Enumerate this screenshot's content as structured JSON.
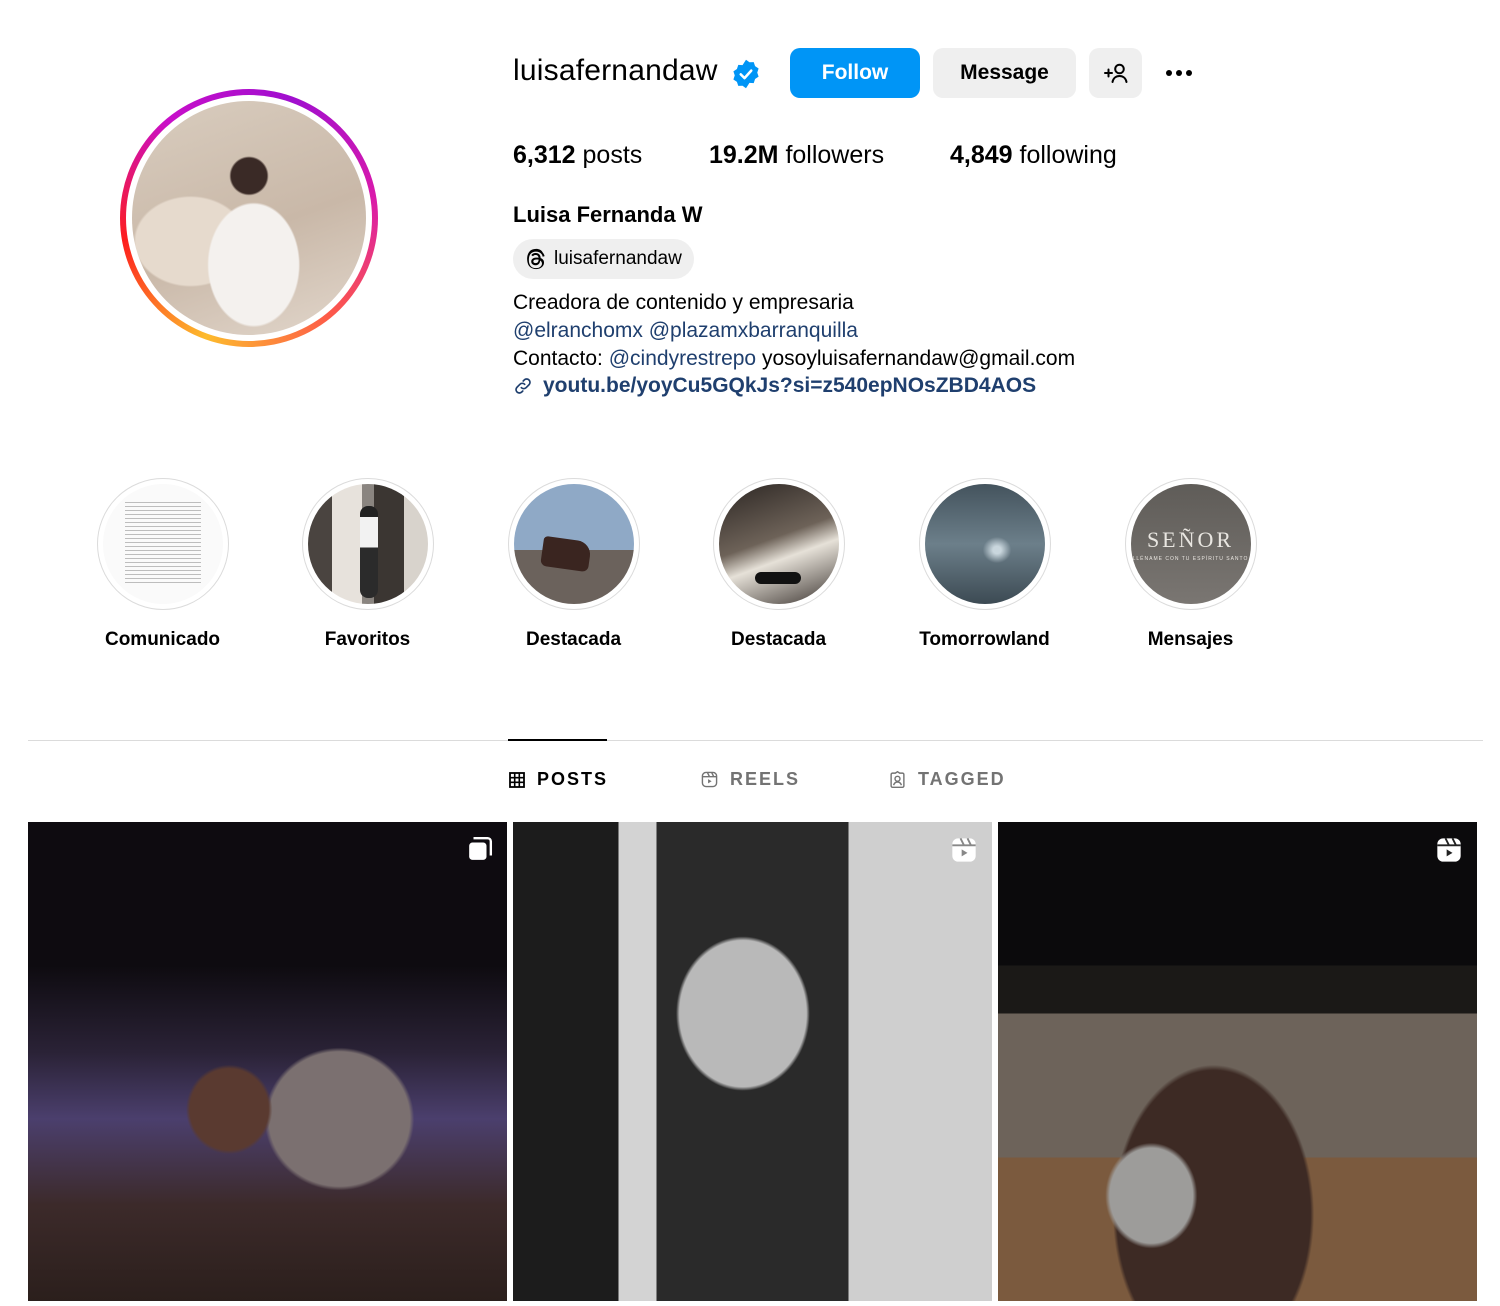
{
  "profile": {
    "username": "luisafernandaw",
    "verified": true,
    "full_name": "Luisa Fernanda W",
    "threads_handle": "luisafernandaw",
    "accent_color": "#0095f6",
    "avatar_alt": "Profile photo"
  },
  "actions": {
    "follow_label": "Follow",
    "message_label": "Message"
  },
  "stats": {
    "posts_count": "6,312",
    "posts_label": "posts",
    "followers_count": "19.2M",
    "followers_label": "followers",
    "following_count": "4,849",
    "following_label": "following"
  },
  "bio": {
    "line1": "Creadora de contenido y empresaria",
    "mention1": "@elranchomx",
    "mention2": "@plazamxbarranquilla",
    "contact_prefix": "Contacto:",
    "contact_mention": "@cindyrestrepo",
    "contact_email": "yosoyluisafernandaw@gmail.com",
    "link": "youtu.be/yoyCu5GQkJs?si=z540epNOsZBD4AOS"
  },
  "highlights": [
    {
      "label": "Comunicado"
    },
    {
      "label": "Favoritos"
    },
    {
      "label": "Destacada"
    },
    {
      "label": "Destacada"
    },
    {
      "label": "Tomorrowland"
    },
    {
      "label": "Mensajes"
    }
  ],
  "highlight_text": {
    "mensajes_title": "SEÑOR",
    "mensajes_sub": "LLÉNAME CON TU ESPÍRITU SANTO"
  },
  "tabs": [
    {
      "label": "POSTS",
      "active": true,
      "icon": "grid-icon"
    },
    {
      "label": "REELS",
      "active": false,
      "icon": "reels-icon"
    },
    {
      "label": "TAGGED",
      "active": false,
      "icon": "tagged-icon"
    }
  ],
  "posts": [
    {
      "type": "carousel",
      "icon": "carousel-icon"
    },
    {
      "type": "reel",
      "icon": "reel-icon"
    },
    {
      "type": "reel",
      "icon": "reel-icon"
    }
  ]
}
